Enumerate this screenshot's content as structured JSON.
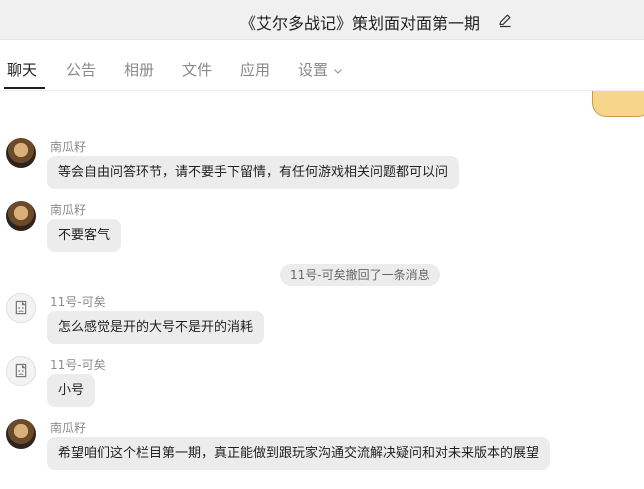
{
  "header": {
    "title": "《艾尔多战记》策划面对面第一期"
  },
  "tabs": [
    {
      "label": "聊天",
      "active": true
    },
    {
      "label": "公告",
      "active": false
    },
    {
      "label": "相册",
      "active": false
    },
    {
      "label": "文件",
      "active": false
    },
    {
      "label": "应用",
      "active": false
    },
    {
      "label": "设置",
      "active": false
    }
  ],
  "messages": [
    {
      "sender": "南瓜籽",
      "text": "等会自由问答环节，请不要手下留情，有任何游戏相关问题都可以问"
    },
    {
      "sender": "南瓜籽",
      "text": "不要客气"
    },
    {
      "sender": "11号-可矣",
      "text": "怎么感觉是开的大号不是开的消耗"
    },
    {
      "sender": "11号-可矣",
      "text": "小号"
    },
    {
      "sender": "南瓜籽",
      "text": "希望咱们这个栏目第一期，真正能做到跟玩家沟通交流解决疑问和对未来版本的展望"
    }
  ],
  "system_notice": "11号-可矣撤回了一条消息",
  "colors": {
    "titlebar_bg": "#f0f0f0",
    "bubble_bg": "#ececec",
    "tab_inactive": "#8a8a8a",
    "tab_active": "#1f1f1f"
  }
}
